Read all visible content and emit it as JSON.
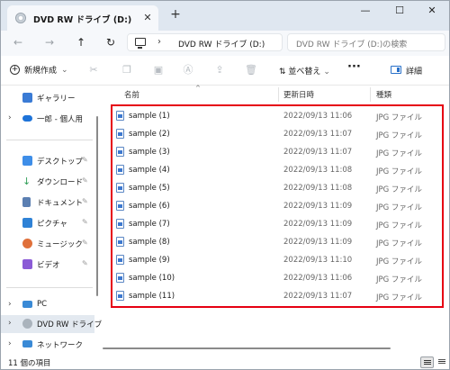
{
  "window": {
    "tab_title": "DVD RW ドライブ (D:)",
    "close_glyph": "✕",
    "new_tab_glyph": "+",
    "minimize_glyph": "—",
    "maximize_glyph": "☐",
    "window_close_glyph": "✕"
  },
  "nav": {
    "back_glyph": "←",
    "forward_glyph": "→",
    "up_glyph": "↑",
    "refresh_glyph": "↻",
    "separator": "›",
    "breadcrumb": "DVD RW ドライブ (D:)",
    "search_placeholder": "DVD RW ドライブ (D:)の検索"
  },
  "toolbar": {
    "new_label": "新規作成",
    "new_chevron": "⌄",
    "sort_label": "並べ替え",
    "sort_chevron": "⌄",
    "more_label": "···",
    "details_label": "詳細",
    "icons": [
      "cut-icon",
      "copy-icon",
      "paste-icon",
      "rename-icon",
      "share-icon",
      "delete-icon"
    ]
  },
  "sidebar": {
    "items": [
      {
        "label": "ギャラリー",
        "icon": "gallery-icon",
        "color": "#3a7bd5"
      },
      {
        "label": "一郎 - 個人用",
        "icon": "cloud-icon",
        "color": "#1e73d8"
      },
      {
        "label": "デスクトップ",
        "icon": "desktop-icon",
        "color": "#3e8ee8"
      },
      {
        "label": "ダウンロード",
        "icon": "download-icon",
        "color": "#2f9e57"
      },
      {
        "label": "ドキュメント",
        "icon": "documents-icon",
        "color": "#5b7fb2"
      },
      {
        "label": "ピクチャ",
        "icon": "pictures-icon",
        "color": "#2f82d6"
      },
      {
        "label": "ミュージック",
        "icon": "music-icon",
        "color": "#e0703a"
      },
      {
        "label": "ビデオ",
        "icon": "videos-icon",
        "color": "#8b5bd6"
      },
      {
        "label": "PC",
        "icon": "pc-icon",
        "color": "#3a8ad6"
      },
      {
        "label": "DVD RW ドライブ",
        "icon": "dvd-drive-icon",
        "color": "#aab3bc"
      },
      {
        "label": "ネットワーク",
        "icon": "network-icon",
        "color": "#3a8ad6"
      }
    ]
  },
  "columns": {
    "name": "名前",
    "date": "更新日時",
    "type": "種類",
    "sort_glyph": "^"
  },
  "files": [
    {
      "name": "sample (1)",
      "date": "2022/09/13 11:06",
      "type": "JPG ファイル"
    },
    {
      "name": "sample (2)",
      "date": "2022/09/13 11:07",
      "type": "JPG ファイル"
    },
    {
      "name": "sample (3)",
      "date": "2022/09/13 11:07",
      "type": "JPG ファイル"
    },
    {
      "name": "sample (4)",
      "date": "2022/09/13 11:08",
      "type": "JPG ファイル"
    },
    {
      "name": "sample (5)",
      "date": "2022/09/13 11:08",
      "type": "JPG ファイル"
    },
    {
      "name": "sample (6)",
      "date": "2022/09/13 11:09",
      "type": "JPG ファイル"
    },
    {
      "name": "sample (7)",
      "date": "2022/09/13 11:09",
      "type": "JPG ファイル"
    },
    {
      "name": "sample (8)",
      "date": "2022/09/13 11:09",
      "type": "JPG ファイル"
    },
    {
      "name": "sample (9)",
      "date": "2022/09/13 11:10",
      "type": "JPG ファイル"
    },
    {
      "name": "sample (10)",
      "date": "2022/09/13 11:06",
      "type": "JPG ファイル"
    },
    {
      "name": "sample (11)",
      "date": "2022/09/13 11:07",
      "type": "JPG ファイル"
    }
  ],
  "status": {
    "item_count": "11 個の項目"
  },
  "colors": {
    "highlight": "#e60012",
    "accent": "#2870c9"
  }
}
